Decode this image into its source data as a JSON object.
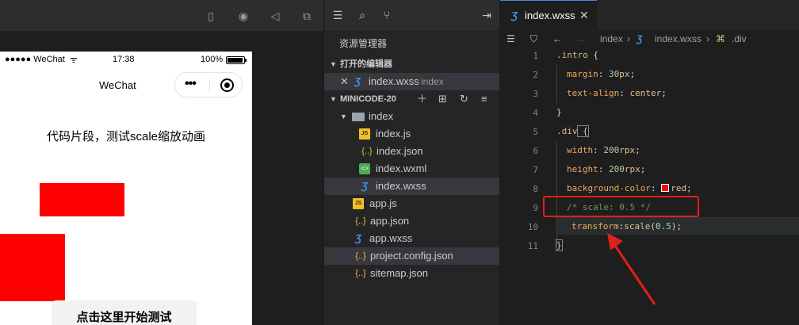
{
  "simulator": {
    "status_signal": "●●●●● WeChat",
    "status_time": "17:38",
    "status_battery": "100%",
    "nav_title": "WeChat",
    "capsule_dots": "•••",
    "intro_text": "代码片段，测试scale缩放动画",
    "start_button": "点击这里开始测试"
  },
  "explorer": {
    "title": "资源管理器",
    "open_editors_section": "打开的编辑器",
    "open_editor": {
      "name": "index.wxss",
      "folder": "index"
    },
    "project_section": "MINICODE-20",
    "tree": [
      {
        "name": "index",
        "type": "folder",
        "depth": 1
      },
      {
        "name": "index.js",
        "type": "js",
        "depth": 2
      },
      {
        "name": "index.json",
        "type": "json",
        "depth": 2
      },
      {
        "name": "index.wxml",
        "type": "wxml",
        "depth": 2
      },
      {
        "name": "index.wxss",
        "type": "css",
        "depth": 2,
        "selected": true
      },
      {
        "name": "app.js",
        "type": "js",
        "depth": 1
      },
      {
        "name": "app.json",
        "type": "json",
        "depth": 1
      },
      {
        "name": "app.wxss",
        "type": "css",
        "depth": 1
      },
      {
        "name": "project.config.json",
        "type": "json",
        "depth": 1,
        "selected": true
      },
      {
        "name": "sitemap.json",
        "type": "json",
        "depth": 1
      }
    ]
  },
  "editor": {
    "tab_label": "index.wxss",
    "breadcrumb": [
      "index",
      "index.wxss",
      ".div"
    ],
    "line_numbers": [
      "1",
      "2",
      "3",
      "4",
      "5",
      "6",
      "7",
      "8",
      "9",
      "10",
      "11"
    ],
    "code": {
      "l1_sel": ".intro",
      "l2_prop": "margin",
      "l2_num": "30",
      "l2_unit": "px",
      "l3_prop": "text-align",
      "l3_val": "center",
      "l5_sel": ".div",
      "l6_prop": "width",
      "l6_num": "200",
      "l6_unit": "rpx",
      "l7_prop": "height",
      "l7_num": "200",
      "l7_unit": "rpx",
      "l8_prop": "background-color",
      "l8_val": "red",
      "l9_comment": "/* scale: 0.5 */",
      "l10_prop": "transform",
      "l10_fn": "scale",
      "l10_arg": "0.5"
    }
  },
  "colors": {
    "annotation_red": "#e0201b",
    "element_red": "#ff0000",
    "accent_blue": "#3b8eea"
  }
}
